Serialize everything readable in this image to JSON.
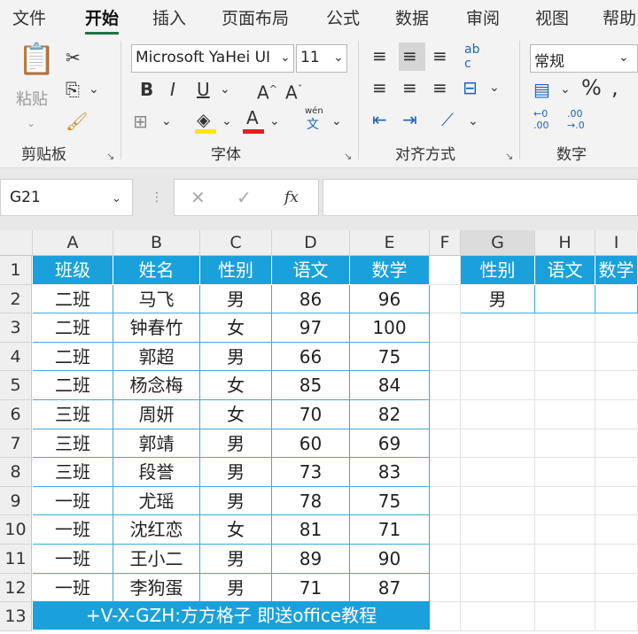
{
  "menu": {
    "tabs": [
      "文件",
      "开始",
      "插入",
      "页面布局",
      "公式",
      "数据",
      "审阅",
      "视图",
      "帮助"
    ]
  },
  "ribbon": {
    "groups": [
      "剪贴板",
      "字体",
      "对齐方式",
      "数字"
    ],
    "paste_label": "粘贴",
    "font_name": "Microsoft YaHei UI",
    "font_size": "11",
    "number_format": "常规",
    "wen_label": "wén",
    "wen_char": "文",
    "ab_label": "ab",
    "ab_label2": "c",
    "dec_inc": "←0 .00",
    "dec_dec": ".00 →.0"
  },
  "formula_bar": {
    "name_box": "G21",
    "fx": "fx",
    "formula": ""
  },
  "columns": [
    "A",
    "B",
    "C",
    "D",
    "E",
    "F",
    "G",
    "H",
    "I"
  ],
  "rows": [
    "1",
    "2",
    "3",
    "4",
    "5",
    "6",
    "7",
    "8",
    "9",
    "10",
    "11",
    "12",
    "13"
  ],
  "table": {
    "headers": [
      "班级",
      "姓名",
      "性别",
      "语文",
      "数学"
    ],
    "rows": [
      [
        "二班",
        "马飞",
        "男",
        "86",
        "96"
      ],
      [
        "二班",
        "钟春竹",
        "女",
        "97",
        "100"
      ],
      [
        "二班",
        "郭超",
        "男",
        "66",
        "75"
      ],
      [
        "二班",
        "杨念梅",
        "女",
        "85",
        "84"
      ],
      [
        "三班",
        "周妍",
        "女",
        "70",
        "82"
      ],
      [
        "三班",
        "郭靖",
        "男",
        "60",
        "69"
      ],
      [
        "三班",
        "段誉",
        "男",
        "73",
        "83"
      ],
      [
        "一班",
        "尤瑶",
        "男",
        "78",
        "75"
      ],
      [
        "一班",
        "沈红恋",
        "女",
        "81",
        "71"
      ],
      [
        "一班",
        "王小二",
        "男",
        "89",
        "90"
      ],
      [
        "一班",
        "李狗蛋",
        "男",
        "71",
        "87"
      ]
    ],
    "banner": "+V-X-GZH:方方格子 即送office教程"
  },
  "criteria": {
    "headers": [
      "性别",
      "语文",
      "数学"
    ],
    "value": "男"
  },
  "colors": {
    "accent": "#1aa1db",
    "excel_green": "#217346"
  }
}
